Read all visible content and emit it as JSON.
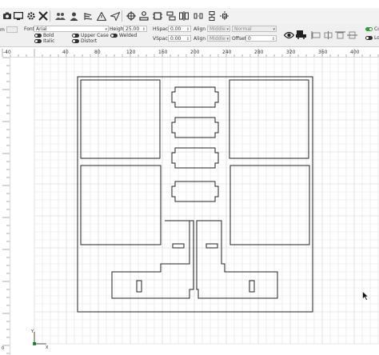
{
  "toolbar": {
    "icons": [
      "camera-icon",
      "monitor-icon",
      "gear-icon",
      "tools-icon",
      "users-icon",
      "user-icon",
      "align-icon",
      "warning-icon",
      "send-icon",
      "target-icon",
      "network-icon",
      "frame-icon",
      "mirror-icon",
      "distribute-icon",
      "center-icon"
    ]
  },
  "text_options": {
    "font_label": "Font",
    "font_value": "Arial",
    "height_label": "Height",
    "height_value": "25.00",
    "hspace_label": "HSpace",
    "hspace_value": "0.00",
    "vspace_label": "VSpace",
    "vspace_value": "0.00",
    "alignx_label": "Align X",
    "alignx_value": "Middle",
    "aligny_label": "Align Y",
    "aligny_value": "Middle",
    "normal_value": "Normal",
    "offset_label": "Offset",
    "offset_value": "0",
    "bold_label": "Bold",
    "italic_label": "Italic",
    "uppercase_label": "Upper Case",
    "welded_label": "Welded",
    "distort_label": "Distort",
    "partial_label_1": "Co",
    "partial_label_2": "Lo",
    "partial_field": "m"
  },
  "rulers": {
    "h_labels": [
      "-40",
      "40",
      "80",
      "120",
      "160",
      "200",
      "240",
      "280",
      "320",
      "360",
      "400"
    ],
    "v_labels": [
      "0"
    ]
  },
  "canvas": {
    "axis_x_label": "X",
    "axis_y_label": "Y",
    "grid_color": "#e3e3e3",
    "major_grid_color": "#cfcfcf",
    "shape_color": "#222222"
  }
}
